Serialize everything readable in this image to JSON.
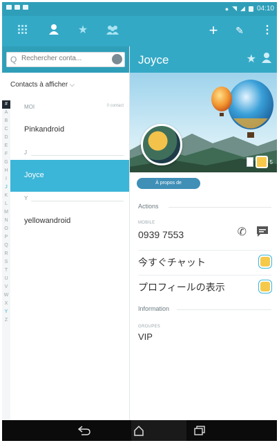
{
  "status_bar": {
    "time": "04:10"
  },
  "toolbar": {
    "icons": [
      "grid-icon",
      "person-icon",
      "star-icon",
      "groups-icon",
      "add-icon",
      "edit-icon",
      "more-vert-icon"
    ]
  },
  "search": {
    "placeholder": "Rechercher conta..."
  },
  "contacts_filter": {
    "label": "Contacts à afficher",
    "chevron": "⌵"
  },
  "alphabet": [
    "#",
    "A",
    "B",
    "C",
    "D",
    "E",
    "F",
    "G",
    "H",
    "I",
    "J",
    "K",
    "L",
    "M",
    "N",
    "O",
    "P",
    "Q",
    "R",
    "S",
    "T",
    "U",
    "V",
    "W",
    "X",
    "Y",
    "Z"
  ],
  "list": {
    "moi_header": "MOI",
    "moi_count": "0 contact",
    "pinkandroid": "Pinkandroid",
    "j_header": "J",
    "joyce": "Joyce",
    "y_header": "Y",
    "yellowandroid": "yellowandroid"
  },
  "detail": {
    "name": "Joyce",
    "about_button": "À propos de",
    "actions_title": "Actions",
    "mobile_label": "MOBILE",
    "phone": "0939 7553",
    "chat_label": "今すぐチャット",
    "profile_label": "プロフィールの表示",
    "information_title": "Information",
    "groups_label": "GROUPES",
    "group_value": "VIP",
    "hero_badge_text": "5"
  },
  "colors": {
    "accent": "#34a9c6",
    "selected": "#3bb5d8",
    "status_bar": "#2f9fb9",
    "nav_bar": "#0b0b0b"
  }
}
